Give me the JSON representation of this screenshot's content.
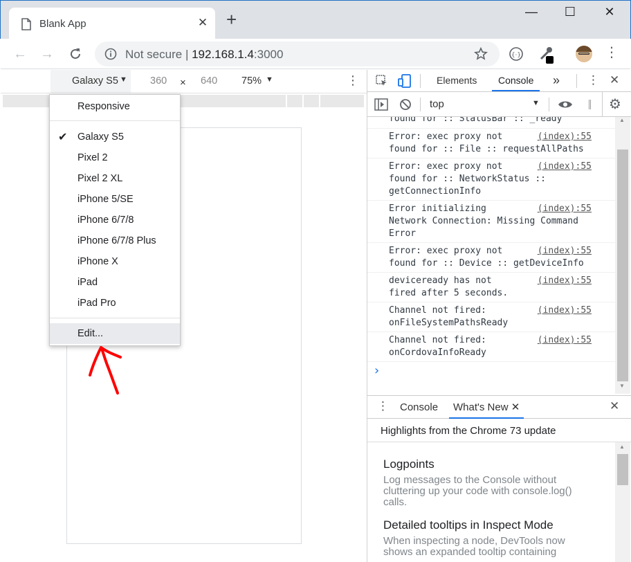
{
  "browser": {
    "tab_title": "Blank App",
    "tab_close": "✕",
    "new_tab": "+",
    "window_controls": {
      "minimize": "—",
      "maximize": "☐",
      "close": "✕"
    },
    "omnibox": {
      "security": "Not secure",
      "separator": "|",
      "host": "192.168.1.4",
      "port": ":3000"
    }
  },
  "device_toolbar": {
    "device": "Galaxy S5",
    "width": "360",
    "times": "×",
    "height": "640",
    "zoom": "75%"
  },
  "device_menu": {
    "items": [
      {
        "label": "Responsive",
        "checked": false
      },
      {
        "label": "Galaxy S5",
        "checked": true
      },
      {
        "label": "Pixel 2",
        "checked": false
      },
      {
        "label": "Pixel 2 XL",
        "checked": false
      },
      {
        "label": "iPhone 5/SE",
        "checked": false
      },
      {
        "label": "iPhone 6/7/8",
        "checked": false
      },
      {
        "label": "iPhone 6/7/8 Plus",
        "checked": false
      },
      {
        "label": "iPhone X",
        "checked": false
      },
      {
        "label": "iPad",
        "checked": false
      },
      {
        "label": "iPad Pro",
        "checked": false
      },
      {
        "label": "Edit...",
        "checked": false
      }
    ]
  },
  "devtools": {
    "tabs": {
      "elements": "Elements",
      "console": "Console",
      "more": "»"
    },
    "context": "top",
    "log": [
      {
        "text": "found for :: StatusBar :: _ready",
        "src": ""
      },
      {
        "text": "Error: exec proxy not\nfound for :: File :: requestAllPaths",
        "src": "(index):55"
      },
      {
        "text": "Error: exec proxy not\nfound for :: NetworkStatus ::\ngetConnectionInfo",
        "src": "(index):55"
      },
      {
        "text": "Error initializing\nNetwork Connection: Missing Command\nError",
        "src": "(index):55"
      },
      {
        "text": "Error: exec proxy not\nfound for :: Device :: getDeviceInfo",
        "src": "(index):55"
      },
      {
        "text": "deviceready has not\nfired after 5 seconds.",
        "src": "(index):55"
      },
      {
        "text": "Channel not fired:\nonFileSystemPathsReady",
        "src": "(index):55"
      },
      {
        "text": "Channel not fired:\nonCordovaInfoReady",
        "src": "(index):55"
      }
    ],
    "prompt": "›",
    "drawer": {
      "console_tab": "Console",
      "whatsnew_tab": "What's New",
      "heading": "Highlights from the Chrome 73 update",
      "items": [
        {
          "title": "Logpoints",
          "desc": "Log messages to the Console without cluttering up your code with console.log() calls."
        },
        {
          "title": "Detailed tooltips in Inspect Mode",
          "desc": "When inspecting a node, DevTools now shows an expanded tooltip containing"
        }
      ]
    }
  },
  "colors": {
    "accent": "#1a73e8",
    "annotation_arrow": "#ff0000"
  }
}
